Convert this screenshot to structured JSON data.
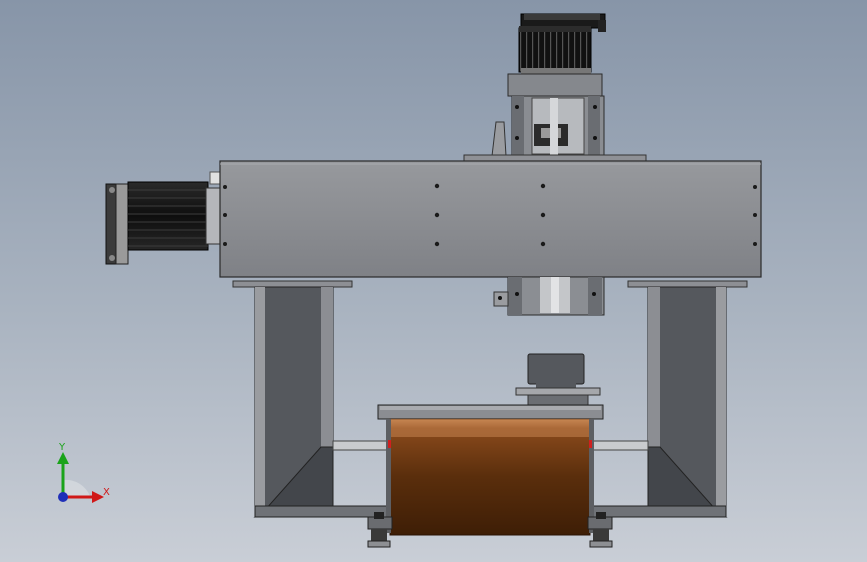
{
  "viewport": {
    "background_top": "#8795a8",
    "background_bottom": "#c9ced6",
    "model_colors": {
      "steel": "#8c8e93",
      "steel_dark": "#55585d",
      "motor_black": "#161616",
      "carriage_copper": "#5a2e0c",
      "edge": "#2a2a2a"
    }
  },
  "axis_triad": {
    "y_label": "Y",
    "x_label": "X",
    "y_color": "#1aa31a",
    "x_color": "#d01818",
    "z_color": "#1f2fb8"
  }
}
